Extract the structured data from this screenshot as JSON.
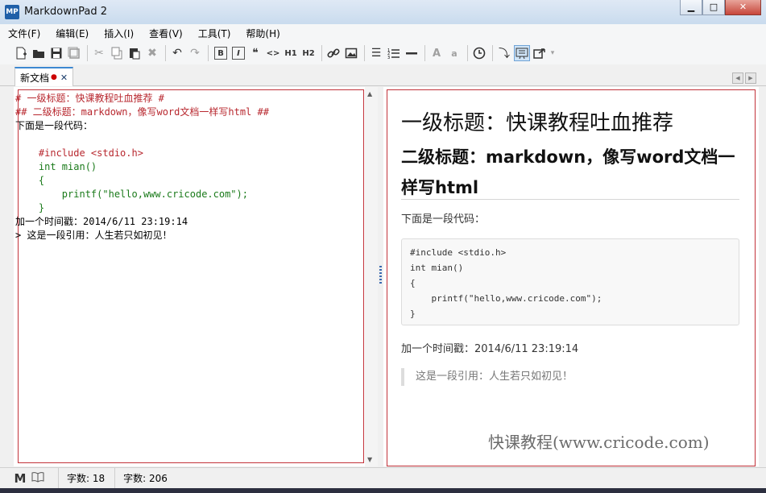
{
  "window": {
    "app_icon_text": "MP",
    "title": "MarkdownPad 2",
    "min": "▁",
    "max": "□",
    "close": "✕"
  },
  "menu": [
    "文件(F)",
    "编辑(E)",
    "插入(I)",
    "查看(V)",
    "工具(T)",
    "帮助(H)"
  ],
  "toolbar": {
    "bold": "B",
    "italic": "I",
    "quote": "❝",
    "code": "<>",
    "h1": "H1",
    "h2": "H2",
    "font_large": "A",
    "font_small": "a"
  },
  "tabs": {
    "doc_title": "新文档",
    "modified": "●",
    "close": "✕",
    "nav_left": "◀",
    "nav_right": "▶"
  },
  "editor": {
    "lines": [
      "# 一级标题：快课教程吐血推荐 #",
      "## 二级标题：markdown，像写word文档一样写html ##",
      "下面是一段代码：",
      "",
      "    #include <stdio.h>",
      "    int mian()",
      "    {",
      "        printf(\"hello,www.cricode.com\");",
      "    }",
      "加一个时间戳：2014/6/11 23:19:14",
      "> 这是一段引用：人生若只如初见！"
    ],
    "scroll_up": "▲",
    "scroll_down": "▼"
  },
  "preview": {
    "h1": "一级标题：快课教程吐血推荐",
    "h2": "二级标题：markdown，像写word文档一样写html",
    "paragraph": "下面是一段代码：",
    "code_lines": [
      "#include <stdio.h>",
      "int mian()",
      "{",
      "    printf(\"hello,www.cricode.com\");",
      "}"
    ],
    "timestamp": "加一个时间戳：2014/6/11 23:19:14",
    "blockquote": "这是一段引用：人生若只如初见！",
    "watermark": "快课教程(www.cricode.com)"
  },
  "status": {
    "markdown_icon": "M",
    "words": "字数: 18",
    "chars": "字数: 206"
  },
  "colors": {
    "markdown_syntax": "#b8282f",
    "code_green": "#1a7a1a",
    "pane_border": "#c2323a"
  }
}
